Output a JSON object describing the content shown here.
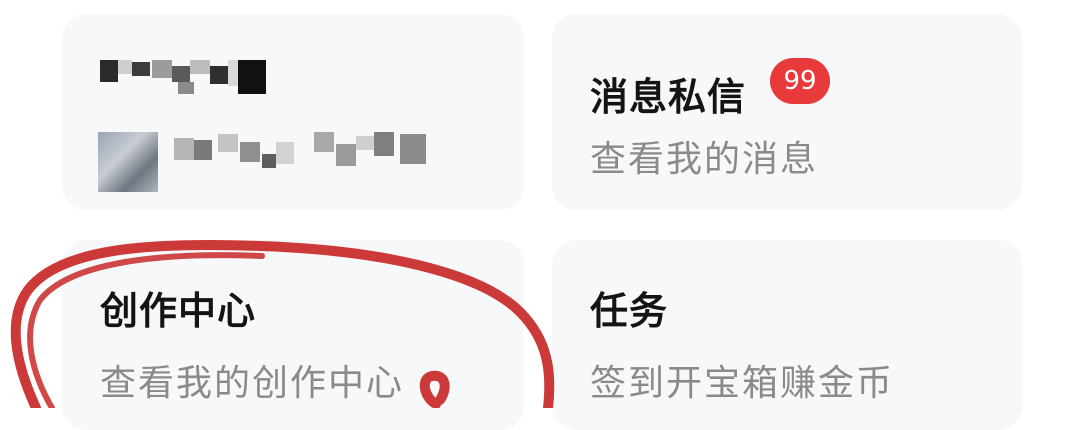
{
  "cards": {
    "messages": {
      "title": "消息私信",
      "badge": "99",
      "subtitle": "查看我的消息"
    },
    "creator": {
      "title": "创作中心",
      "subtitle": "查看我的创作中心"
    },
    "tasks": {
      "title": "任务",
      "subtitle": "签到开宝箱赚金币"
    }
  },
  "colors": {
    "card_background": "#f7f8fa",
    "badge": "#e83a3a",
    "title_text": "#141414",
    "subtitle_text": "#8a8a8a",
    "annotation_stroke": "#c82828"
  },
  "icons": {
    "redacted_name": "pixelated-blur",
    "redacted_thumbnail": "image-thumbnail"
  }
}
